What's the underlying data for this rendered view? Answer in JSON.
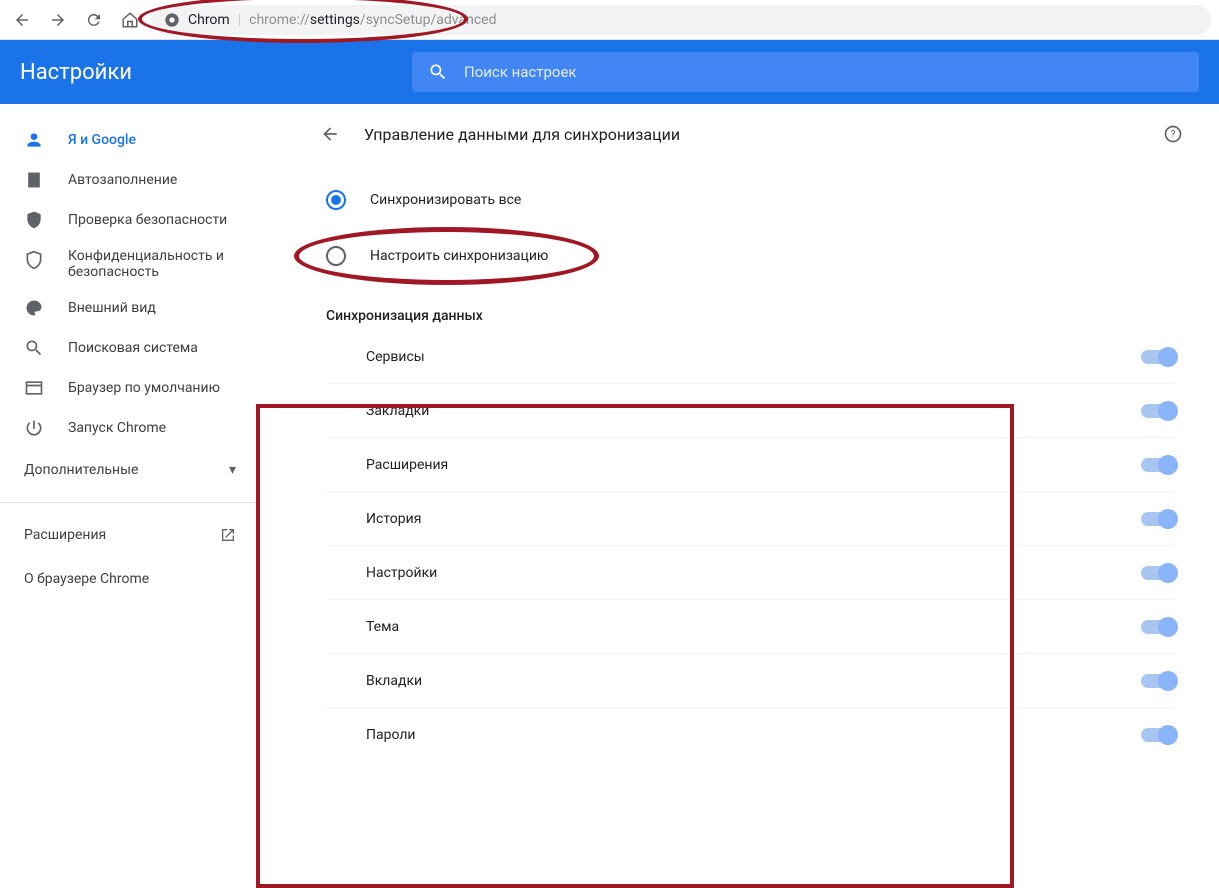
{
  "url": {
    "prefix": "Chrom",
    "scheme": "chrome://",
    "highlight": "settings",
    "rest": "/syncSetup/advanced"
  },
  "topbar": {
    "title": "Настройки",
    "search_placeholder": "Поиск настроек"
  },
  "sidebar": {
    "items": [
      {
        "label": "Я и Google"
      },
      {
        "label": "Автозаполнение"
      },
      {
        "label": "Проверка безопасности"
      },
      {
        "label": "Конфиденциальность и безопасность"
      },
      {
        "label": "Внешний вид"
      },
      {
        "label": "Поисковая система"
      },
      {
        "label": "Браузер по умолчанию"
      },
      {
        "label": "Запуск Chrome"
      }
    ],
    "advanced": "Дополнительные",
    "extensions": "Расширения",
    "about": "О браузере Chrome"
  },
  "page": {
    "title": "Управление данными для синхронизации",
    "radio_all": "Синхронизировать все",
    "radio_custom": "Настроить синхронизацию",
    "section": "Синхронизация данных",
    "rows": [
      {
        "label": "Сервисы"
      },
      {
        "label": "Закладки"
      },
      {
        "label": "Расширения"
      },
      {
        "label": "История"
      },
      {
        "label": "Настройки"
      },
      {
        "label": "Тема"
      },
      {
        "label": "Вкладки"
      },
      {
        "label": "Пароли"
      }
    ]
  }
}
